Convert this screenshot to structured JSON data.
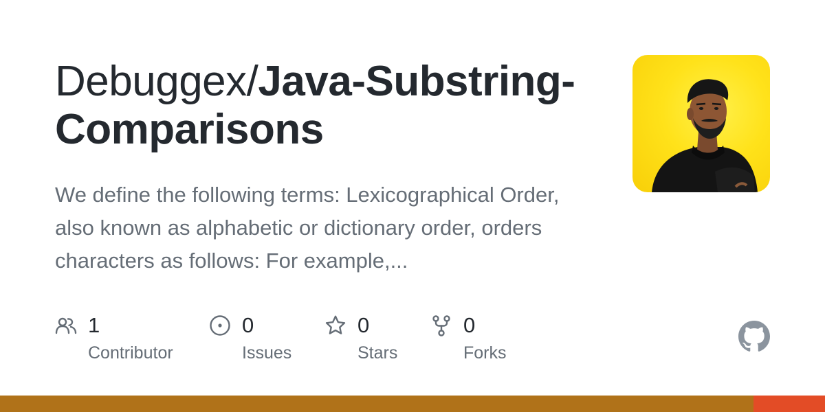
{
  "repo": {
    "owner": "Debuggex/",
    "name": "Java-Substring-Comparisons",
    "description": "We define the following terms: Lexicographical Order, also known as alphabetic or dictionary order, orders characters as follows: For example,..."
  },
  "avatar": {
    "background_color": "#FFE21A"
  },
  "stats": [
    {
      "icon": "people-icon",
      "count": "1",
      "label": "Contributor"
    },
    {
      "icon": "issue-opened-icon",
      "count": "0",
      "label": "Issues"
    },
    {
      "icon": "star-icon",
      "count": "0",
      "label": "Stars"
    },
    {
      "icon": "repo-forked-icon",
      "count": "0",
      "label": "Forks"
    }
  ],
  "branding": {
    "logo_icon": "github-mark-icon"
  },
  "language_bar": [
    {
      "color": "#B07219",
      "share": 0.913
    },
    {
      "color": "#E34C26",
      "share": 0.087
    }
  ]
}
